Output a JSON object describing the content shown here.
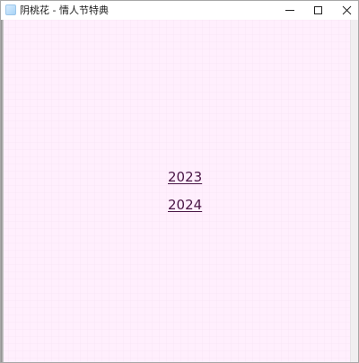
{
  "window": {
    "title": "阴桃花 - 情人节特典",
    "app_icon": "app-icon",
    "controls": [
      "minimize-icon",
      "maximize-icon",
      "close-icon"
    ]
  },
  "content": {
    "background_color": "#ffeffd",
    "link_color": "#4a1646",
    "years": [
      {
        "label": "2023"
      },
      {
        "label": "2024"
      }
    ]
  }
}
